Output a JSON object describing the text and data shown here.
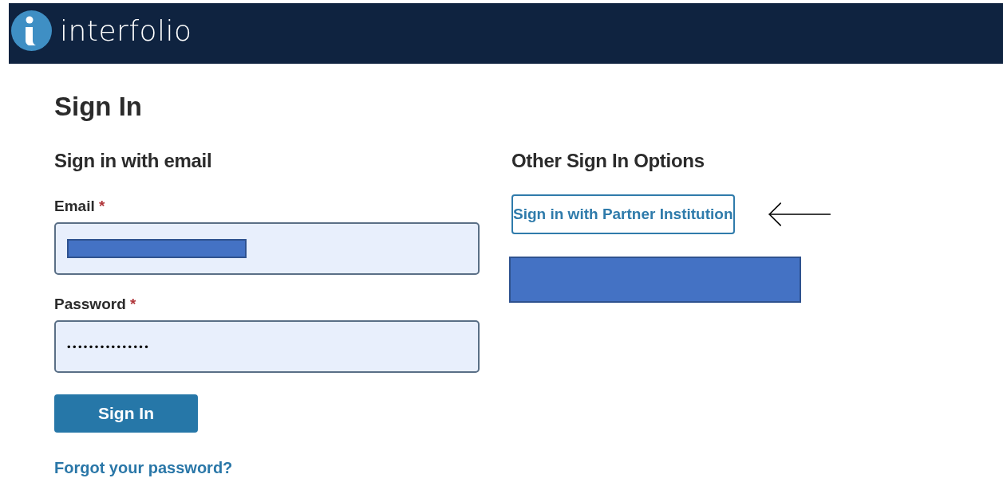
{
  "header": {
    "logo_text": "interfolio"
  },
  "page_title": "Sign In",
  "email_section": {
    "heading": "Sign in with email",
    "fields": [
      {
        "label": "Email",
        "required_mark": "*",
        "redacted": true
      },
      {
        "label": "Password",
        "required_mark": "*",
        "value": "•••••••••••••••",
        "redacted": false
      }
    ],
    "submit_button": "Sign In",
    "forgot_link": "Forgot your password?"
  },
  "other_section": {
    "heading": "Other Sign In Options",
    "partner_button": "Sign in with Partner Institution"
  }
}
